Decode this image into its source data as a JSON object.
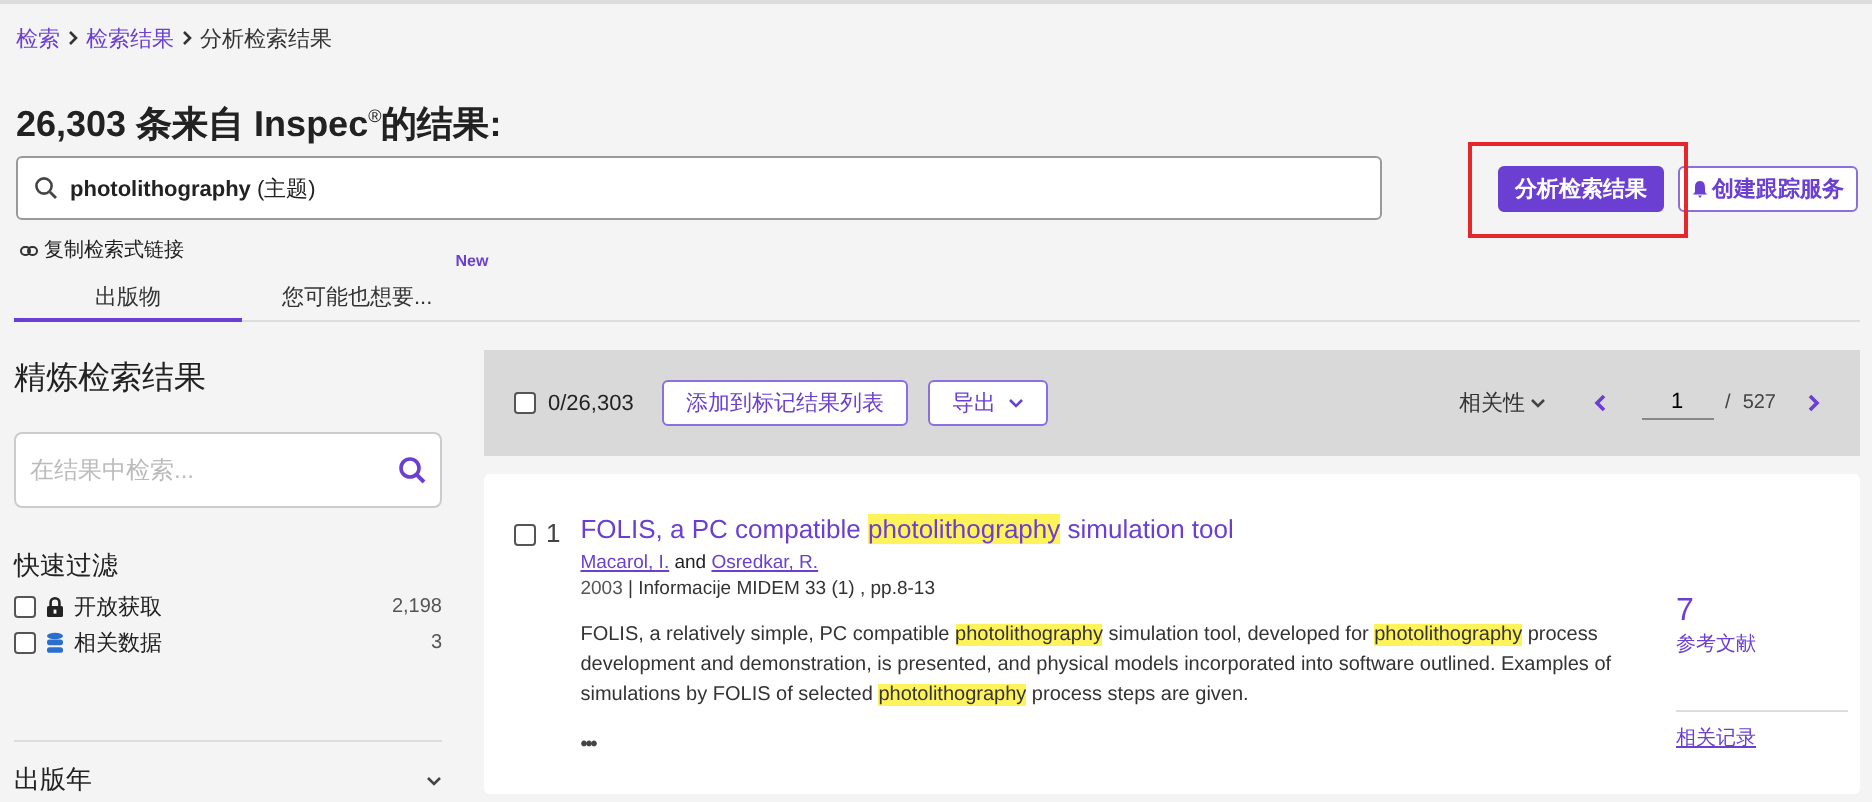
{
  "breadcrumb": [
    {
      "label": "检索",
      "current": false
    },
    {
      "label": "检索结果",
      "current": false
    },
    {
      "label": "分析检索结果",
      "current": true
    }
  ],
  "heading": "26,303 条来自 Inspec$^{®}$的结果:",
  "search": {
    "value": "**photolithography** (主题)"
  },
  "buttons": [
    {
      "label": "分析检索结果",
      "kind": "primary",
      "highlighted": true
    },
    {
      "label": "创建跟踪服务",
      "kind": "outline",
      "highlighted": false
    }
  ],
  "copy_link": "复制检索式链接",
  "tabs": [
    {
      "label": "出版物",
      "selected": true
    },
    {
      "label": "您可能也想要...",
      "selected": false,
      "badge": "New"
    }
  ],
  "refine": {
    "title": "精炼检索结果",
    "search": {
      "placeholder": "在结果中检索..."
    },
    "quick_filter": {
      "title": "快速过滤",
      "items": [
        {
          "kind": "lock",
          "label": "开放获取",
          "count": "2,198",
          "checked": false
        },
        {
          "kind": "database",
          "label": "相关数据",
          "count": "3",
          "checked": false
        }
      ]
    },
    "sections": [
      {
        "title": "出版年",
        "expanded": false
      }
    ]
  },
  "toolbar": {
    "select_all": {
      "label": "0/26,303",
      "checked": false
    },
    "buttons": [
      {
        "label": "添加到标记结果列表",
        "dropdown": false
      },
      {
        "label": "导出",
        "dropdown": true
      }
    ],
    "sort": "相关性",
    "page": "1",
    "separator": "/",
    "total_pages": "527"
  },
  "results": [
    {
      "number": "1",
      "checked": false,
      "title": [
        {
          "text": "FOLIS, a PC compatible ",
          "highlighted": false
        },
        {
          "text": "photolithography",
          "highlighted": true
        },
        {
          "text": " simulation tool",
          "highlighted": false
        }
      ],
      "authors": [
        "Macarol, I.",
        "Osredkar, R."
      ],
      "author_joiner": "and",
      "year": "2003",
      "meta_separator": "|",
      "source": "Informacije MIDEM 33 (1) , pp.8-13",
      "abstract": [
        {
          "text": "FOLIS, a relatively simple, PC compatible ",
          "highlighted": false
        },
        {
          "text": "photolithography",
          "highlighted": true
        },
        {
          "text": " simulation tool, developed for ",
          "highlighted": false
        },
        {
          "text": "photolithography",
          "highlighted": true
        },
        {
          "text": " process development and demonstration, is presented, and physical models incorporated into software outlined. Examples of simulations by FOLIS of selected ",
          "highlighted": false
        },
        {
          "text": "photolithography",
          "highlighted": true
        },
        {
          "text": " process steps are given.",
          "highlighted": false
        }
      ],
      "more": "•••",
      "citations": "7",
      "citations_label": "参考文献",
      "related": "相关记录"
    }
  ]
}
